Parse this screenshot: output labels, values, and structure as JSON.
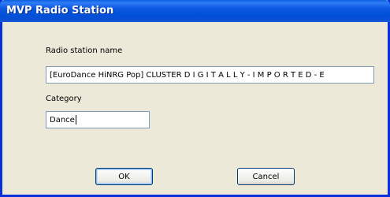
{
  "window": {
    "title": "MVP Radio Station"
  },
  "form": {
    "station_name_label": "Radio station name",
    "station_name_value": "[EuroDance HiNRG Pop] CLUSTER D I G I T A L L Y - I M P O R T E D - E",
    "category_label": "Category",
    "category_value": "Dance"
  },
  "buttons": {
    "ok_label": "OK",
    "cancel_label": "Cancel"
  },
  "colors": {
    "titlebar": "#0054e3",
    "window_border": "#0831d9",
    "dialog_background": "#ece9d8"
  }
}
